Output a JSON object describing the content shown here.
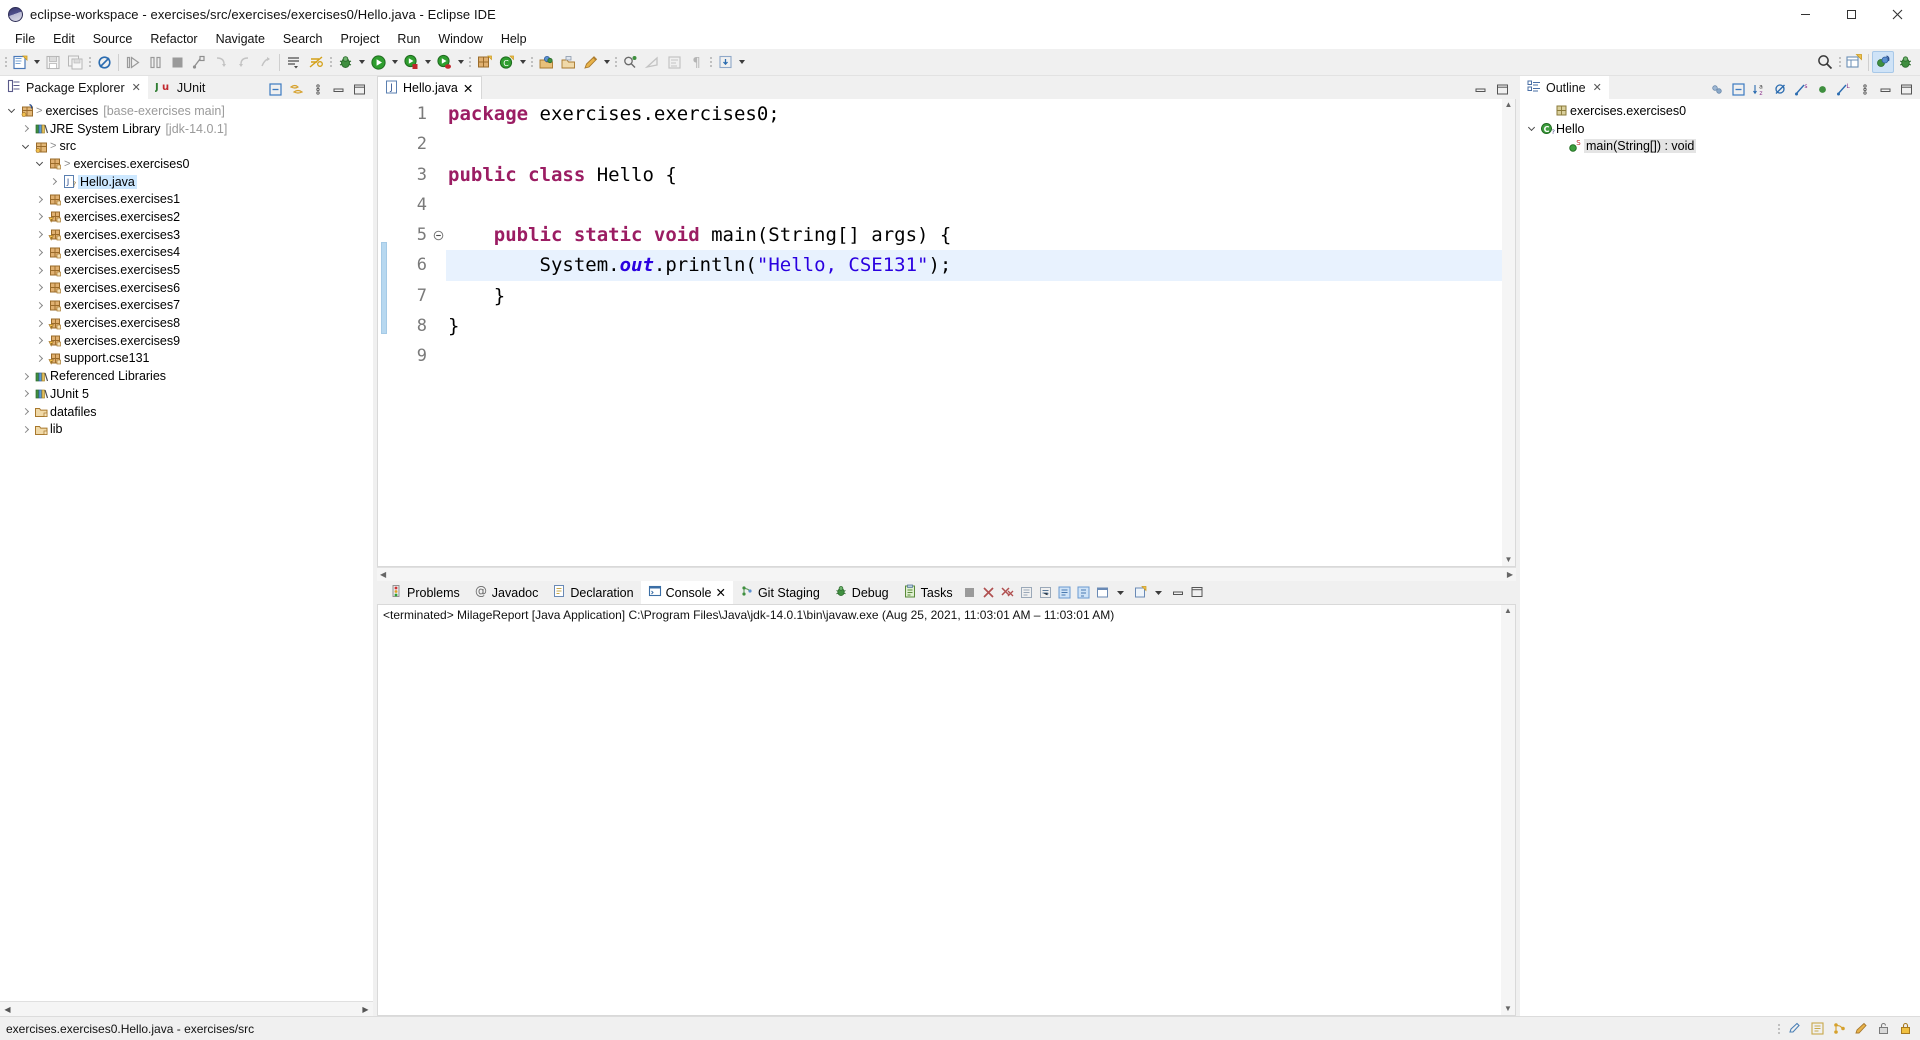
{
  "window": {
    "title": "eclipse-workspace - exercises/src/exercises/exercises0/Hello.java - Eclipse IDE",
    "logo_icon": "eclipse-logo-icon",
    "minimize_icon": "minimize-icon",
    "maximize_icon": "maximize-icon",
    "close_icon": "close-icon"
  },
  "menubar": {
    "items": [
      {
        "label": "File"
      },
      {
        "label": "Edit"
      },
      {
        "label": "Source"
      },
      {
        "label": "Refactor"
      },
      {
        "label": "Navigate"
      },
      {
        "label": "Search"
      },
      {
        "label": "Project"
      },
      {
        "label": "Run"
      },
      {
        "label": "Window"
      },
      {
        "label": "Help"
      }
    ]
  },
  "toolbar": {
    "items": [
      {
        "name": "new-wizard-icon"
      },
      {
        "name": "new-wizard-dropdown-icon"
      },
      {
        "name": "save-icon"
      },
      {
        "name": "save-all-icon"
      },
      {
        "name": "link-with-editor-icon"
      },
      {
        "name": "debug-step-over-icon"
      },
      {
        "name": "debug-pause-icon"
      },
      {
        "name": "debug-terminate-icon"
      },
      {
        "name": "debug-disconnect-icon"
      },
      {
        "name": "step-into-icon"
      },
      {
        "name": "step-return-icon"
      },
      {
        "name": "step-out-icon"
      },
      {
        "name": "open-task-icon"
      },
      {
        "name": "skip-breakpoints-icon"
      },
      {
        "name": "debug-bug-icon"
      },
      {
        "name": "debug-dropdown-icon"
      },
      {
        "name": "run-icon"
      },
      {
        "name": "run-dropdown-icon"
      },
      {
        "name": "coverage-icon"
      },
      {
        "name": "coverage-dropdown-icon"
      },
      {
        "name": "profile-icon"
      },
      {
        "name": "profile-dropdown-icon"
      },
      {
        "name": "new-java-package-icon"
      },
      {
        "name": "new-java-class-icon"
      },
      {
        "name": "new-java-class-dropdown-icon"
      },
      {
        "name": "open-type-icon"
      },
      {
        "name": "open-task-folder-icon"
      },
      {
        "name": "pencil-edit-icon"
      },
      {
        "name": "pencil-dropdown-icon"
      },
      {
        "name": "search-declaration-icon"
      },
      {
        "name": "next-annotation-icon"
      },
      {
        "name": "previous-edit-icon"
      },
      {
        "name": "show-whitespace-icon"
      },
      {
        "name": "restore-icon"
      },
      {
        "name": "restore-dropdown-icon"
      }
    ],
    "right_items": [
      {
        "name": "quick-access-search-icon"
      },
      {
        "name": "new-perspective-icon"
      },
      {
        "name": "java-perspective-icon",
        "active": true
      },
      {
        "name": "debug-perspective-icon"
      }
    ]
  },
  "package_explorer": {
    "tabs": [
      {
        "label": "Package Explorer",
        "icon": "package-explorer-icon",
        "active": true,
        "closeable": true
      },
      {
        "label": "JUnit",
        "icon": "junit-icon",
        "active": false,
        "closeable": false
      }
    ],
    "tools": [
      {
        "name": "collapse-all-icon"
      },
      {
        "name": "link-with-editor-icon"
      },
      {
        "name": "view-menu-icon"
      },
      {
        "name": "minimize-view-icon"
      },
      {
        "name": "maximize-view-icon"
      }
    ],
    "tree": [
      {
        "indent": 0,
        "twist": "down",
        "icon": "java-project-icon",
        "gt": true,
        "label": "exercises",
        "sub": "[base-exercises main]"
      },
      {
        "indent": 1,
        "twist": "right",
        "icon": "library-icon",
        "gt": false,
        "label": "JRE System Library",
        "sub": "[jdk-14.0.1]"
      },
      {
        "indent": 1,
        "twist": "down",
        "icon": "source-folder-icon",
        "gt": true,
        "label": "src",
        "sub": ""
      },
      {
        "indent": 2,
        "twist": "down",
        "icon": "package-icon",
        "gt": true,
        "label": "exercises.exercises0",
        "sub": ""
      },
      {
        "indent": 3,
        "twist": "right",
        "icon": "java-file-icon",
        "gt": false,
        "label": "Hello.java",
        "sub": "",
        "selected": true
      },
      {
        "indent": 2,
        "twist": "right",
        "icon": "package-icon",
        "gt": false,
        "label": "exercises.exercises1",
        "sub": ""
      },
      {
        "indent": 2,
        "twist": "right",
        "icon": "package-warn-icon",
        "gt": false,
        "label": "exercises.exercises2",
        "sub": ""
      },
      {
        "indent": 2,
        "twist": "right",
        "icon": "package-warn-icon",
        "gt": false,
        "label": "exercises.exercises3",
        "sub": ""
      },
      {
        "indent": 2,
        "twist": "right",
        "icon": "package-icon",
        "gt": false,
        "label": "exercises.exercises4",
        "sub": ""
      },
      {
        "indent": 2,
        "twist": "right",
        "icon": "package-icon",
        "gt": false,
        "label": "exercises.exercises5",
        "sub": ""
      },
      {
        "indent": 2,
        "twist": "right",
        "icon": "package-icon",
        "gt": false,
        "label": "exercises.exercises6",
        "sub": ""
      },
      {
        "indent": 2,
        "twist": "right",
        "icon": "package-icon",
        "gt": false,
        "label": "exercises.exercises7",
        "sub": ""
      },
      {
        "indent": 2,
        "twist": "right",
        "icon": "package-warn-icon",
        "gt": false,
        "label": "exercises.exercises8",
        "sub": ""
      },
      {
        "indent": 2,
        "twist": "right",
        "icon": "package-warn-icon",
        "gt": false,
        "label": "exercises.exercises9",
        "sub": ""
      },
      {
        "indent": 2,
        "twist": "right",
        "icon": "package-warn-icon",
        "gt": false,
        "label": "support.cse131",
        "sub": ""
      },
      {
        "indent": 1,
        "twist": "right",
        "icon": "library-icon",
        "gt": false,
        "label": "Referenced Libraries",
        "sub": ""
      },
      {
        "indent": 1,
        "twist": "right",
        "icon": "library-icon",
        "gt": false,
        "label": "JUnit 5",
        "sub": ""
      },
      {
        "indent": 1,
        "twist": "right",
        "icon": "folder-icon",
        "gt": false,
        "label": "datafiles",
        "sub": ""
      },
      {
        "indent": 1,
        "twist": "right",
        "icon": "folder-icon",
        "gt": false,
        "label": "lib",
        "sub": ""
      }
    ]
  },
  "editor": {
    "tab": {
      "label": "Hello.java",
      "icon": "java-file-icon",
      "closeable": true
    },
    "tools": [
      {
        "name": "minimize-editor-icon"
      },
      {
        "name": "maximize-editor-icon"
      }
    ],
    "line_numbers": [
      "1",
      "2",
      "3",
      "4",
      "5",
      "6",
      "7",
      "8",
      "9"
    ],
    "highlighted_line": 6,
    "lines": [
      {
        "n": 1,
        "tokens": [
          {
            "t": "package",
            "c": "kw"
          },
          {
            "t": " exercises.exercises0;",
            "c": "plain"
          }
        ]
      },
      {
        "n": 2,
        "tokens": []
      },
      {
        "n": 3,
        "tokens": [
          {
            "t": "public class",
            "c": "kw"
          },
          {
            "t": " Hello {",
            "c": "plain"
          }
        ]
      },
      {
        "n": 4,
        "tokens": []
      },
      {
        "n": 5,
        "fold": true,
        "tokens": [
          {
            "t": "    ",
            "c": "plain"
          },
          {
            "t": "public static void",
            "c": "kw"
          },
          {
            "t": " main(String[] args) {",
            "c": "plain"
          }
        ]
      },
      {
        "n": 6,
        "tokens": [
          {
            "t": "        System.",
            "c": "plain"
          },
          {
            "t": "out",
            "c": "fld"
          },
          {
            "t": ".println(",
            "c": "plain"
          },
          {
            "t": "\"Hello, CSE131\"",
            "c": "str"
          },
          {
            "t": ");",
            "c": "plain"
          }
        ]
      },
      {
        "n": 7,
        "tokens": [
          {
            "t": "    }",
            "c": "plain"
          }
        ]
      },
      {
        "n": 8,
        "tokens": [
          {
            "t": "}",
            "c": "plain"
          }
        ]
      },
      {
        "n": 9,
        "tokens": []
      }
    ]
  },
  "console": {
    "tabs": [
      {
        "label": "Problems",
        "icon": "problems-icon",
        "active": false,
        "closeable": false
      },
      {
        "label": "Javadoc",
        "icon": "javadoc-icon",
        "active": false,
        "closeable": false
      },
      {
        "label": "Declaration",
        "icon": "declaration-icon",
        "active": false,
        "closeable": false
      },
      {
        "label": "Console",
        "icon": "console-icon",
        "active": true,
        "closeable": true
      },
      {
        "label": "Git Staging",
        "icon": "git-staging-icon",
        "active": false,
        "closeable": false
      },
      {
        "label": "Debug",
        "icon": "debug-icon",
        "active": false,
        "closeable": false
      },
      {
        "label": "Tasks",
        "icon": "tasks-icon",
        "active": false,
        "closeable": false
      }
    ],
    "tools": [
      {
        "name": "terminate-icon"
      },
      {
        "name": "remove-launch-icon"
      },
      {
        "name": "remove-all-terminated-icon"
      },
      {
        "name": "scroll-lock-icon"
      },
      {
        "name": "word-wrap-icon"
      },
      {
        "name": "pin-console-icon"
      },
      {
        "name": "display-selected-console-icon"
      },
      {
        "name": "open-console-icon"
      },
      {
        "name": "open-console-dropdown-icon"
      },
      {
        "name": "new-console-view-icon"
      },
      {
        "name": "new-console-dropdown-icon"
      },
      {
        "name": "minimize-console-icon"
      },
      {
        "name": "maximize-console-icon"
      }
    ],
    "output": "<terminated> MilageReport [Java Application] C:\\Program Files\\Java\\jdk-14.0.1\\bin\\javaw.exe  (Aug 25, 2021, 11:03:01 AM – 11:03:01 AM)"
  },
  "outline": {
    "tab": {
      "label": "Outline",
      "icon": "outline-icon",
      "closeable": true
    },
    "tools": [
      {
        "name": "focus-on-active-task-icon"
      },
      {
        "name": "collapse-all-icon"
      },
      {
        "name": "sort-alphabetically-icon"
      },
      {
        "name": "hide-fields-icon"
      },
      {
        "name": "hide-static-icon"
      },
      {
        "name": "hide-non-public-icon"
      },
      {
        "name": "hide-local-types-icon"
      },
      {
        "name": "view-menu-icon"
      },
      {
        "name": "minimize-view-icon"
      },
      {
        "name": "maximize-view-icon"
      }
    ],
    "tree": [
      {
        "indent": 1,
        "twist": "none",
        "icon": "package-declaration-icon",
        "label": "exercises.exercises0"
      },
      {
        "indent": 0,
        "twist": "down",
        "icon": "class-icon",
        "label": "Hello"
      },
      {
        "indent": 2,
        "twist": "none",
        "icon": "public-method-static-icon",
        "label": "main(String[]) : void",
        "selected": true
      }
    ]
  },
  "statusbar": {
    "text": "exercises.exercises0.Hello.java - exercises/src",
    "right_icons": [
      {
        "name": "writable-status-icon"
      },
      {
        "name": "smart-insert-icon"
      },
      {
        "name": "git-branch-icon"
      },
      {
        "name": "editor-pencil-icon"
      },
      {
        "name": "unlock-icon"
      },
      {
        "name": "lock-icon"
      }
    ]
  },
  "colors": {
    "keyword": "#9b1d63",
    "string": "#2a00e0",
    "field": "#2a00e0",
    "selection": "#cde8ff",
    "line_highlight": "#e8f2fe",
    "chrome": "#f0f0f0",
    "accent": "#cfe3f7"
  }
}
